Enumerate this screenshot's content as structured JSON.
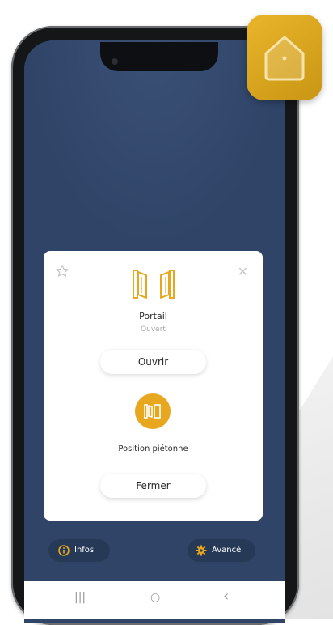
{
  "card": {
    "device_title": "Portail",
    "device_status": "Ouvert",
    "open_label": "Ouvrir",
    "pedestrian_label": "Position piétonne",
    "close_label": "Fermer"
  },
  "footer": {
    "infos_label": "Infos",
    "avance_label": "Avancé"
  },
  "navbar": {
    "recents_glyph": "|||",
    "home_glyph": "○",
    "back_glyph": "‹"
  },
  "colors": {
    "screen_bg": "#2f4467",
    "accent": "#e7a81f",
    "app_icon": "#d8a51f"
  },
  "icons": [
    "home-app-icon",
    "star-icon",
    "close-icon",
    "gate-icon",
    "pedestrian-gate-icon",
    "info-icon",
    "gear-icon"
  ]
}
